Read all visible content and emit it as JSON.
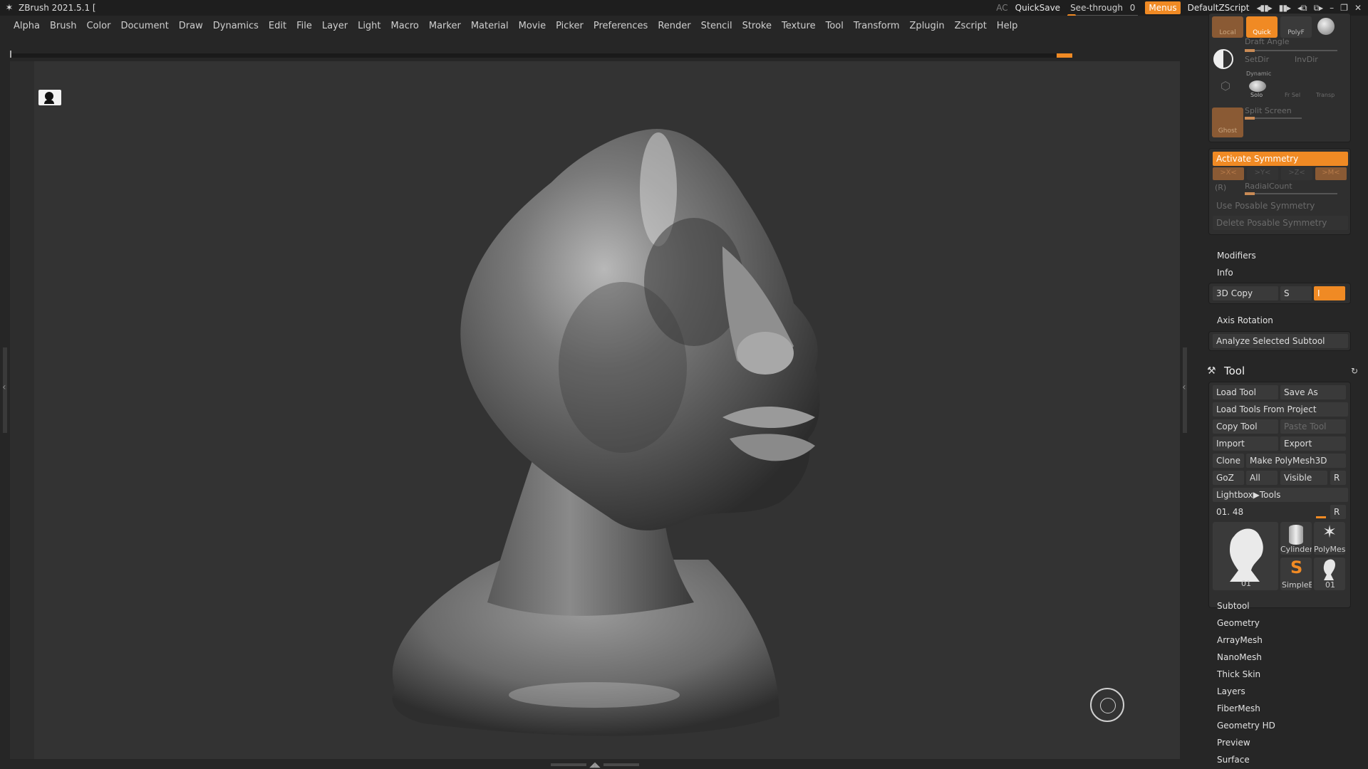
{
  "app": {
    "title": "ZBrush 2021.5.1 ["
  },
  "titlebar": {
    "ac": "AC",
    "quicksave": "QuickSave",
    "see_through_label": "See-through",
    "see_through_value": "0",
    "menus": "Menus",
    "script": "DefaultZScript",
    "accent_color": "#f08a24"
  },
  "menubar": {
    "items": [
      "Alpha",
      "Brush",
      "Color",
      "Document",
      "Draw",
      "Dynamics",
      "Edit",
      "File",
      "Layer",
      "Light",
      "Macro",
      "Marker",
      "Material",
      "Movie",
      "Picker",
      "Preferences",
      "Render",
      "Stencil",
      "Stroke",
      "Texture",
      "Tool",
      "Transform",
      "Zplugin",
      "Zscript",
      "Help"
    ]
  },
  "panel": {
    "top": {
      "local": "Local",
      "quick": "Quick",
      "polyf": "PolyF",
      "draft_angle": "Draft Angle",
      "setdir": "SetDir",
      "invdir": "InvDir",
      "dynamic": "Dynamic",
      "solo": "Solo",
      "fr_sel": "Fr Sel",
      "transp": "Transp",
      "ghost": "Ghost",
      "split_screen": "Split Screen"
    },
    "symmetry": {
      "activate": "Activate Symmetry",
      "x": ">X<",
      "y": ">Y<",
      "z": ">Z<",
      "m": ">M<",
      "r": "(R)",
      "radial_count": "RadialCount",
      "use_posable": "Use Posable Symmetry",
      "delete_posable": "Delete Posable Symmetry"
    },
    "sections_top": {
      "modifiers": "Modifiers",
      "info": "Info"
    },
    "copy3d": {
      "label": "3D Copy",
      "s": "S",
      "i": "I"
    },
    "axis_rotation": "Axis Rotation",
    "analyze": "Analyze Selected Subtool",
    "tool": {
      "title": "Tool",
      "load_tool": "Load Tool",
      "save_as": "Save As",
      "load_from_project": "Load Tools From Project",
      "copy_tool": "Copy Tool",
      "paste_tool": "Paste Tool",
      "import": "Import",
      "export": "Export",
      "clone": "Clone",
      "make_polymesh": "Make PolyMesh3D",
      "goz": "GoZ",
      "all": "All",
      "visible": "Visible",
      "r": "R",
      "lightbox": "Lightbox▶Tools",
      "slider_value": "01. 48",
      "thumbs": {
        "main": "01",
        "cylinder": "Cylinder",
        "polymesh": "PolyMes",
        "simpleb": "SimpleB",
        "small": "01"
      }
    },
    "sub_sections": [
      "Subtool",
      "Geometry",
      "ArrayMesh",
      "NanoMesh",
      "Thick Skin",
      "Layers",
      "FiberMesh",
      "Geometry HD",
      "Preview",
      "Surface"
    ]
  },
  "icons": {
    "logo": "zbrush-logo-icon",
    "camera": "camera-icon",
    "gizmo": "gizmo-icon",
    "hammer": "hammer-icon",
    "reset": "reset-icon"
  }
}
